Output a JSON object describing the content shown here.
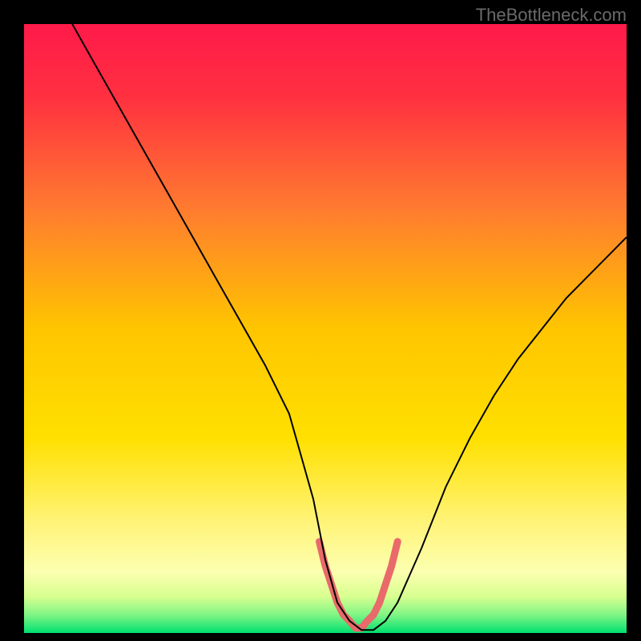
{
  "watermark": "TheBottleneck.com",
  "chart_data": {
    "type": "line",
    "title": "",
    "xlabel": "",
    "ylabel": "",
    "xlim": [
      0,
      100
    ],
    "ylim": [
      0,
      100
    ],
    "background_gradient": {
      "stops": [
        {
          "pos": 0.0,
          "color": "#ff1a4a"
        },
        {
          "pos": 0.12,
          "color": "#ff3040"
        },
        {
          "pos": 0.3,
          "color": "#ff7a30"
        },
        {
          "pos": 0.5,
          "color": "#ffc500"
        },
        {
          "pos": 0.68,
          "color": "#ffe000"
        },
        {
          "pos": 0.82,
          "color": "#fff47a"
        },
        {
          "pos": 0.9,
          "color": "#fcffb0"
        },
        {
          "pos": 0.94,
          "color": "#d8ff90"
        },
        {
          "pos": 0.97,
          "color": "#80f585"
        },
        {
          "pos": 1.0,
          "color": "#00e070"
        }
      ]
    },
    "series": [
      {
        "name": "bottleneck-curve",
        "x": [
          8,
          12,
          16,
          20,
          24,
          28,
          32,
          36,
          40,
          44,
          48,
          50,
          52,
          54,
          56,
          58,
          60,
          62,
          66,
          70,
          74,
          78,
          82,
          86,
          90,
          94,
          98,
          100
        ],
        "y": [
          100,
          93,
          86,
          79,
          72,
          65,
          58,
          51,
          44,
          36,
          22,
          12,
          5,
          2,
          0.5,
          0.5,
          2,
          5,
          14,
          24,
          32,
          39,
          45,
          50,
          55,
          59,
          63,
          65
        ]
      }
    ],
    "highlight": {
      "name": "valley-highlight",
      "color": "#e96a6a",
      "x": [
        49,
        50,
        51,
        52,
        53,
        54,
        55,
        56,
        57,
        58,
        59,
        60,
        61,
        62
      ],
      "y": [
        15,
        11,
        8,
        5,
        3,
        2,
        0.8,
        0.8,
        2,
        3,
        5,
        8,
        11,
        15
      ]
    }
  }
}
